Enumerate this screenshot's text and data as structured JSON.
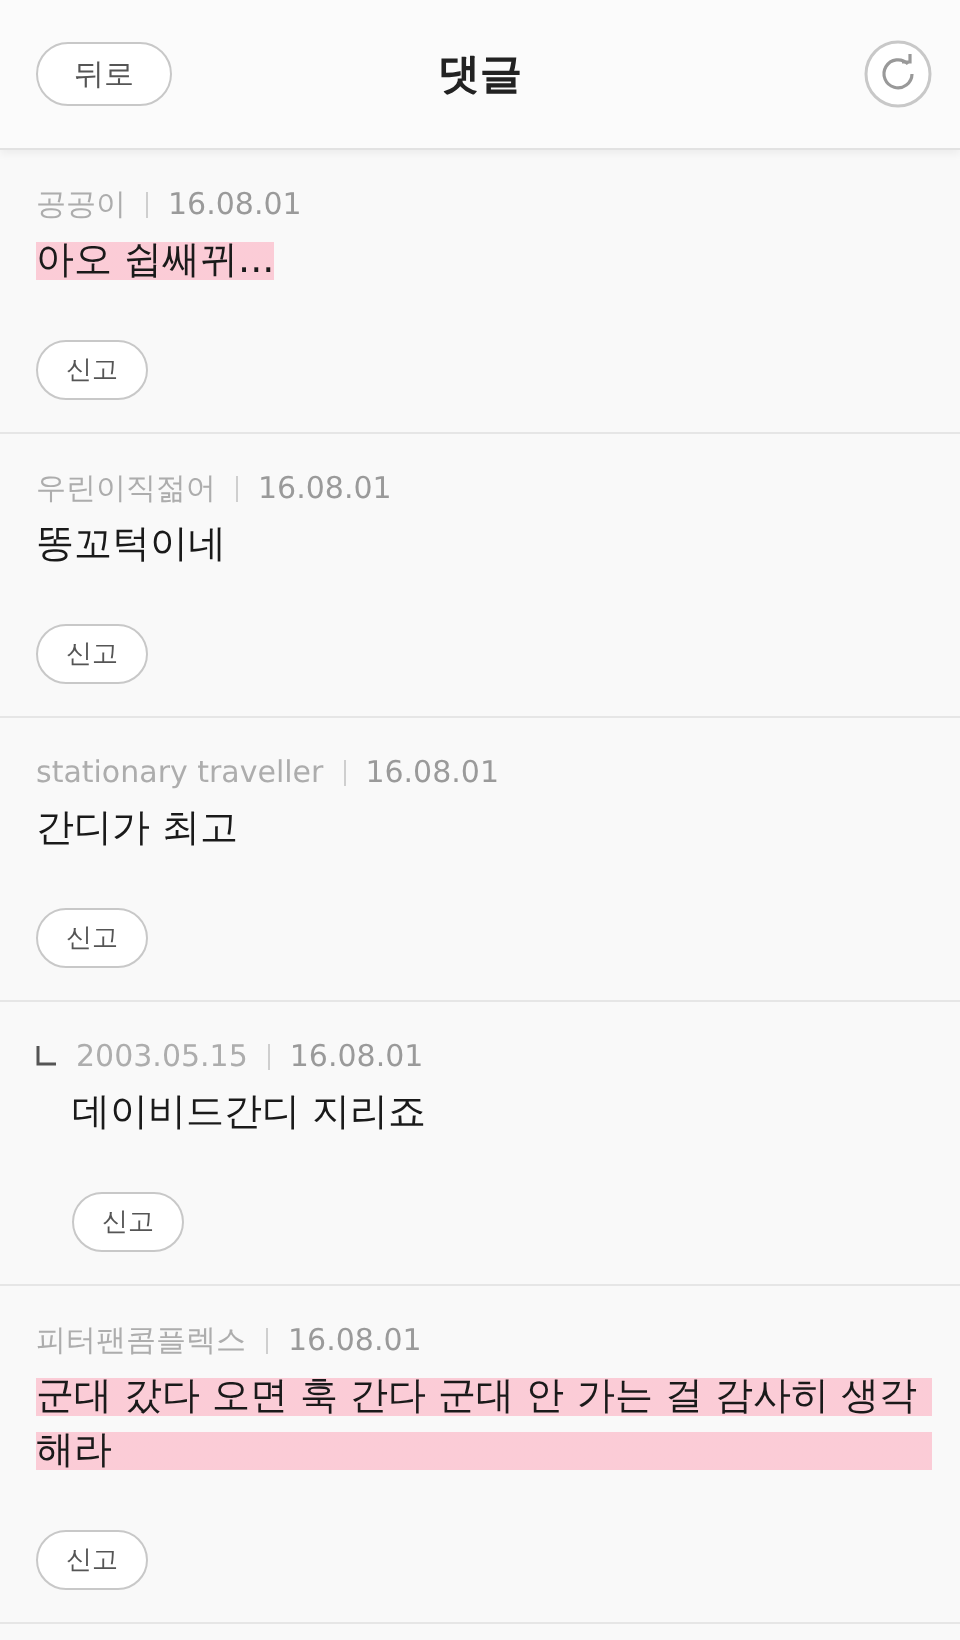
{
  "header": {
    "back_button": "뒤로",
    "title": "댓글"
  },
  "comments": [
    {
      "author": "공공이",
      "date": "16.08.01",
      "text": "아오 쉽쌔뀌...",
      "highlighted": true,
      "report_button": "신고"
    },
    {
      "author": "우린이직젊어",
      "date": "16.08.01",
      "text": "똥꼬턱이네",
      "highlighted": false,
      "report_button": "신고"
    },
    {
      "author": "stationary traveller",
      "date": "16.08.01",
      "text": "간디가 최고",
      "highlighted": false,
      "report_button": "신고",
      "children": [
        {
          "author": "2003.05.15",
          "date": "16.08.01",
          "text": "데이비드간디 지리죠",
          "highlighted": false,
          "report_button": "신고"
        }
      ]
    },
    {
      "author": "피터팬콤플렉스",
      "date": "16.08.01",
      "text": "군대 갔다 오면 훅 간다 군대 안 가는 걸 감사히 생각해라",
      "highlighted": true,
      "report_button": "신고"
    }
  ]
}
